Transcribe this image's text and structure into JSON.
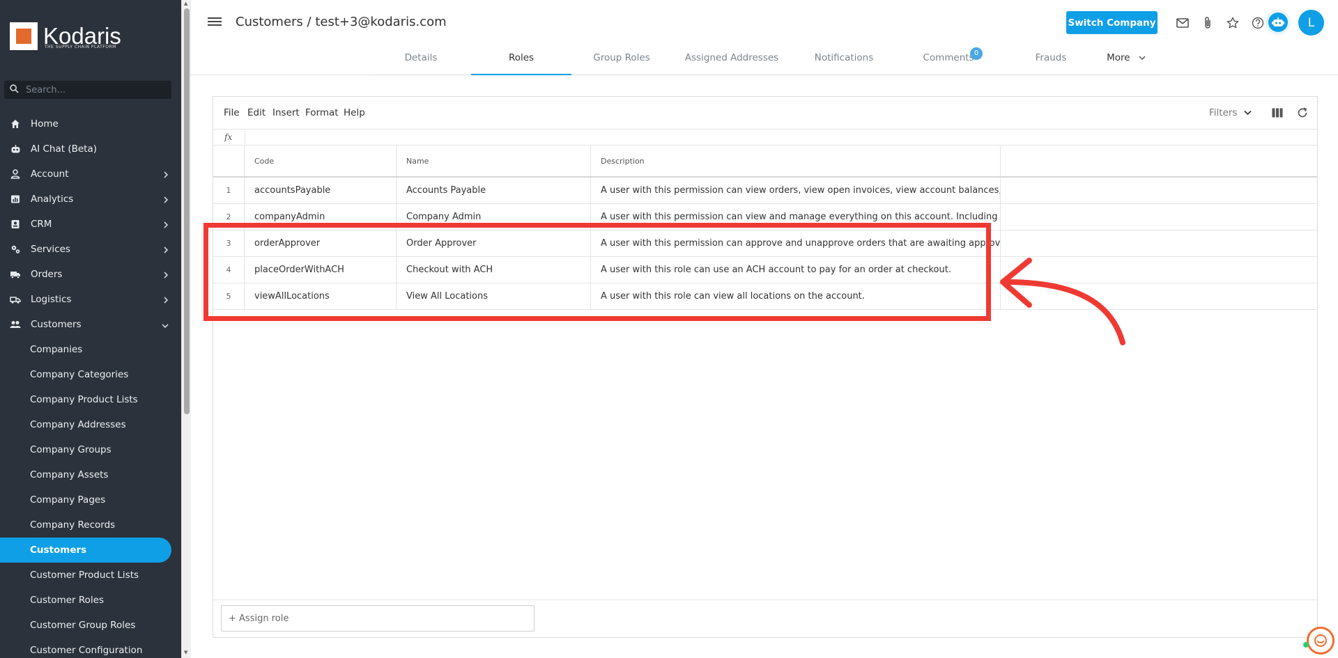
{
  "brand": {
    "name": "Kodaris",
    "tagline": "THE SUPPLY CHAIN PLATFORM"
  },
  "search": {
    "placeholder": "Search..."
  },
  "sidebar": {
    "items": [
      {
        "label": "Home",
        "icon": "home-icon"
      },
      {
        "label": "AI Chat (Beta)",
        "icon": "robot-icon"
      },
      {
        "label": "Account",
        "icon": "person-icon",
        "expandable": true
      },
      {
        "label": "Analytics",
        "icon": "chart-icon",
        "expandable": true
      },
      {
        "label": "CRM",
        "icon": "contact-card-icon",
        "expandable": true
      },
      {
        "label": "Services",
        "icon": "gears-icon",
        "expandable": true
      },
      {
        "label": "Orders",
        "icon": "truck-icon",
        "expandable": true
      },
      {
        "label": "Logistics",
        "icon": "delivery-icon",
        "expandable": true
      },
      {
        "label": "Customers",
        "icon": "people-icon",
        "expandable": true,
        "expanded": true
      }
    ],
    "subitems": [
      {
        "label": "Companies"
      },
      {
        "label": "Company Categories"
      },
      {
        "label": "Company Product Lists"
      },
      {
        "label": "Company Addresses"
      },
      {
        "label": "Company Groups"
      },
      {
        "label": "Company Assets"
      },
      {
        "label": "Company Pages"
      },
      {
        "label": "Company Records"
      },
      {
        "label": "Customers",
        "active": true
      },
      {
        "label": "Customer Product Lists"
      },
      {
        "label": "Customer Roles"
      },
      {
        "label": "Customer Group Roles"
      },
      {
        "label": "Customer Configuration"
      }
    ]
  },
  "header": {
    "title": "Customers / test+3@kodaris.com",
    "switch_company_label": "Switch Company",
    "avatar_initial": "L"
  },
  "tabs": [
    {
      "label": "Details"
    },
    {
      "label": "Roles",
      "active": true
    },
    {
      "label": "Group Roles"
    },
    {
      "label": "Assigned Addresses"
    },
    {
      "label": "Notifications"
    },
    {
      "label": "Comments",
      "badge": "0"
    },
    {
      "label": "Frauds"
    },
    {
      "label": "More"
    }
  ],
  "grid": {
    "menu": [
      "File",
      "Edit",
      "Insert",
      "Format",
      "Help"
    ],
    "filters_label": "Filters",
    "fx_label": "fx",
    "columns": {
      "code": "Code",
      "name": "Name",
      "description": "Description"
    },
    "rows": [
      {
        "num": "1",
        "code": "accountsPayable",
        "name": "Accounts Payable",
        "description": "A user with this permission can view orders, view open invoices, view account balances, and m..."
      },
      {
        "num": "2",
        "code": "companyAdmin",
        "name": "Company Admin",
        "description": "A user with this permission can view and manage everything on this account. Including but not..."
      },
      {
        "num": "3",
        "code": "orderApprover",
        "name": "Order Approver",
        "description": "A user with this permission can approve and unapprove orders that are awaiting approval."
      },
      {
        "num": "4",
        "code": "placeOrderWithACH",
        "name": "Checkout with ACH",
        "description": "A user with this role can use an ACH account to pay for an order at checkout."
      },
      {
        "num": "5",
        "code": "viewAllLocations",
        "name": "View All Locations",
        "description": "A user with this role can view all locations on the account."
      }
    ],
    "assign_label": "+ Assign role"
  },
  "colors": {
    "accent": "#0f9fe6",
    "sidebar": "#2b323b",
    "annotation": "#ef3a33",
    "brand_orange": "#e26a2c"
  }
}
